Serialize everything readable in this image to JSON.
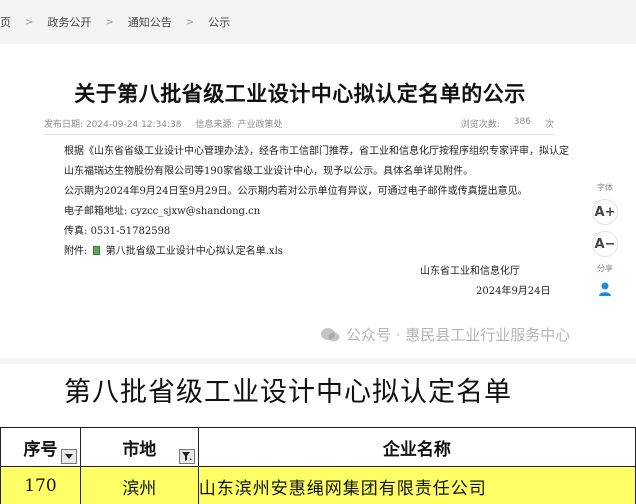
{
  "breadcrumb": [
    "页",
    "政务公开",
    "通知公告",
    "公示"
  ],
  "article": {
    "title": "关于第八批省级工业设计中心拟认定名单的公示",
    "meta": {
      "date_label": "发布日期:",
      "date": "2024-09-24 12:34:38",
      "source_label": "信息来源:",
      "source": "产业政策处",
      "views_label": "浏览次数:",
      "views": "386",
      "views_unit": "次"
    },
    "paragraphs": [
      "根据《山东省省级工业设计中心管理办法》，经各市工信部门推荐，省工业和信息化厅按程序组织专家评审，拟认定山东福瑞达生物股份有限公司等190家省级工业设计中心，现予以公示。具体名单详见附件。",
      "公示期为2024年9月24日至9月29日。公示期内若对公示单位有异议，可通过电子邮件或传真提出意见。"
    ],
    "email_label": "电子邮箱地址:",
    "email": "cyzcc_sjxw@shandong.cn",
    "fax_label": "传真:",
    "fax": "0531-51782598",
    "attachment_label": "附件:",
    "attachment": "第八批省级工业设计中心拟认定名单.xls",
    "signature": "山东省工业和信息化厅",
    "signature_date": "2024年9月24日"
  },
  "side_tools": {
    "font_label": "字体",
    "increase": "A+",
    "decrease": "A−",
    "share_label": "分享"
  },
  "watermark": "公众号 · 惠民县工业行业服务中心",
  "sheet": {
    "title": "第八批省级工业设计中心拟认定名单",
    "headers": [
      "序号",
      "市地",
      "企业名称"
    ],
    "rows": [
      [
        "170",
        "滨州",
        "山东滨州安惠绳网集团有限责任公司"
      ]
    ]
  },
  "colors": {
    "breadcrumb_bg": "#f3f3f3",
    "row_highlight": "#ffff66",
    "share_icon": "#1a8fd6"
  }
}
